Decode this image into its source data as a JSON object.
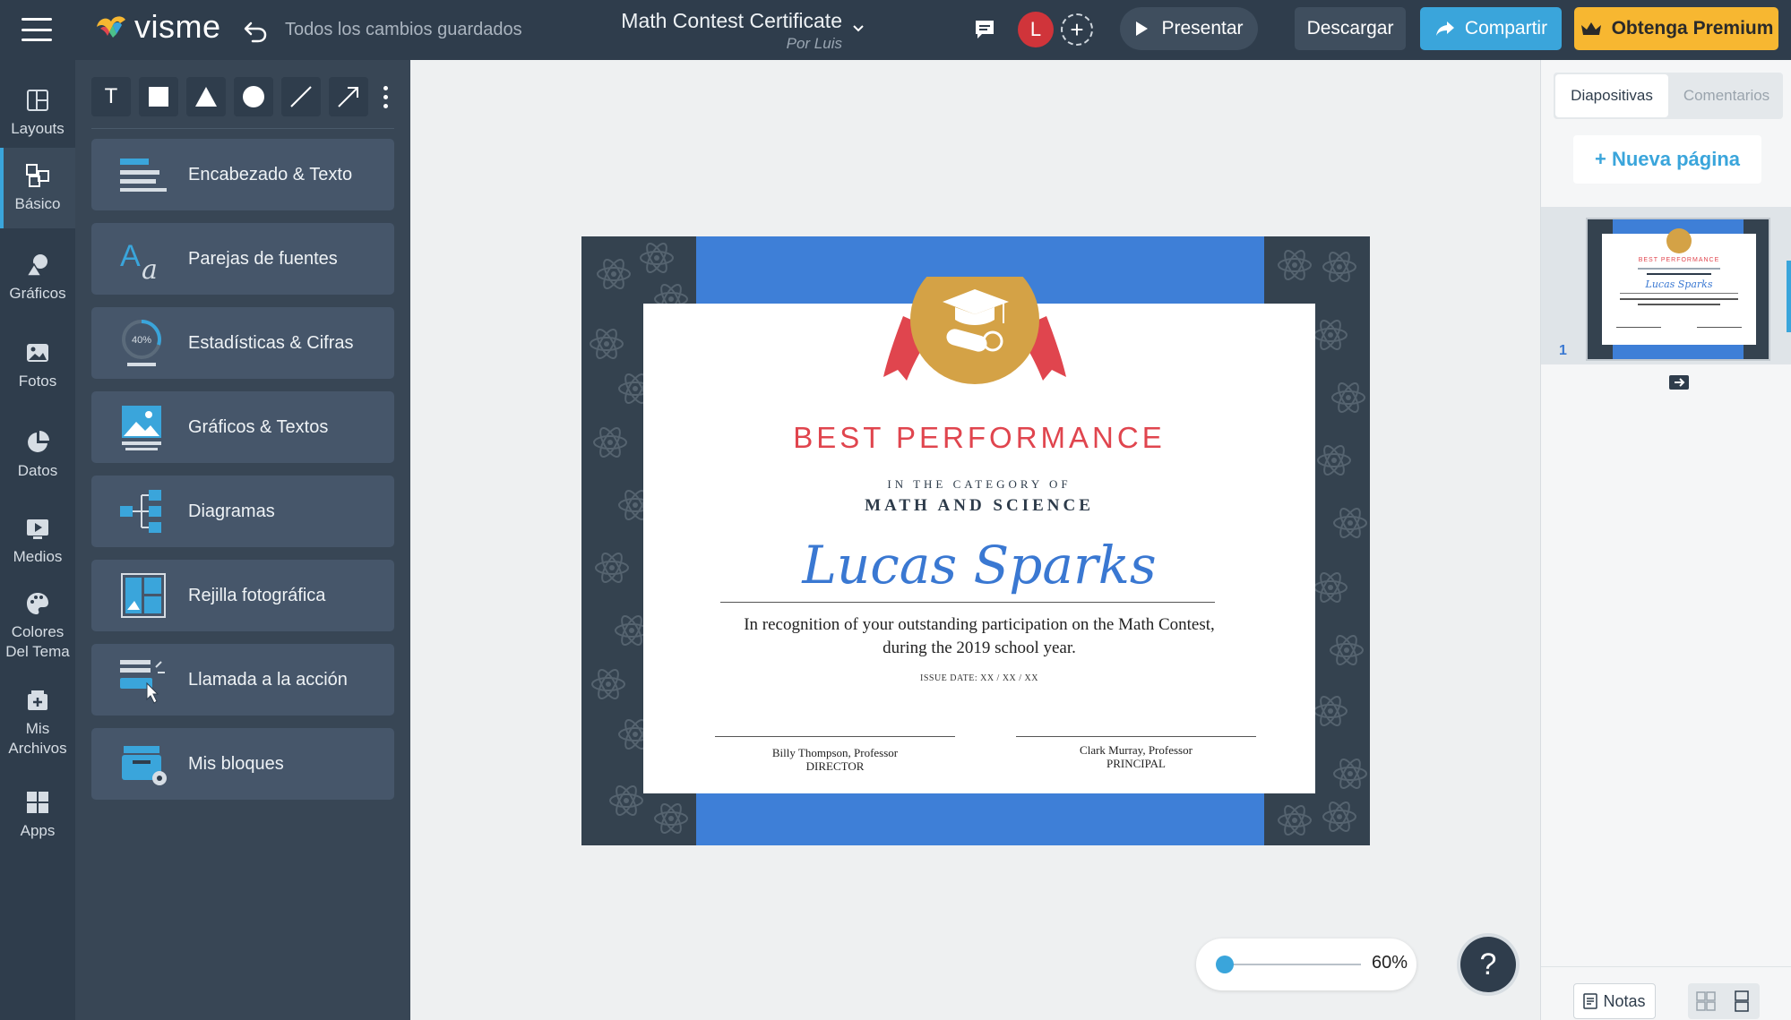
{
  "topbar": {
    "logo_text": "visme",
    "saved_status": "Todos los cambios guardados",
    "doc_title": "Math Contest Certificate",
    "doc_author": "Por Luis",
    "avatar_initial": "L",
    "present_label": "Presentar",
    "download_label": "Descargar",
    "share_label": "Compartir",
    "premium_label": "Obtenga Premium",
    "colors": {
      "bar": "#2f3d4c",
      "share": "#3aa5db",
      "premium": "#f7b731",
      "avatar": "#d0343a"
    }
  },
  "rail": {
    "items": [
      {
        "label": "Layouts",
        "icon": "layouts-icon"
      },
      {
        "label": "Básico",
        "icon": "basic-blocks-icon",
        "active": true
      },
      {
        "label": "Gráficos",
        "icon": "graphics-icon"
      },
      {
        "label": "Fotos",
        "icon": "photos-icon"
      },
      {
        "label": "Datos",
        "icon": "pie-chart-icon"
      },
      {
        "label": "Medios",
        "icon": "media-icon"
      },
      {
        "label": "Colores Del Tema",
        "icon": "palette-icon"
      },
      {
        "label": "Mis Archivos",
        "icon": "my-files-icon"
      },
      {
        "label": "Apps",
        "icon": "apps-icon"
      }
    ]
  },
  "panel": {
    "tools": [
      "text-tool",
      "rectangle-tool",
      "triangle-tool",
      "circle-tool",
      "line-tool",
      "arrow-tool"
    ],
    "text_tool_glyph": "T",
    "blocks": [
      {
        "label": "Encabezado & Texto",
        "icon": "heading-text-icon"
      },
      {
        "label": "Parejas de fuentes",
        "icon": "font-pairs-icon"
      },
      {
        "label": "Estadísticas & Cifras",
        "icon": "stats-figures-icon",
        "icon_text": "40%"
      },
      {
        "label": "Gráficos & Textos",
        "icon": "graphics-text-icon"
      },
      {
        "label": "Diagramas",
        "icon": "diagrams-icon"
      },
      {
        "label": "Rejilla fotográfica",
        "icon": "photo-grid-icon"
      },
      {
        "label": "Llamada a la acción",
        "icon": "call-to-action-icon"
      },
      {
        "label": "Mis bloques",
        "icon": "my-blocks-icon"
      }
    ]
  },
  "certificate": {
    "heading": "BEST PERFORMANCE",
    "category_intro": "IN THE CATEGORY OF",
    "category": "MATH AND SCIENCE",
    "recipient": "Lucas Sparks",
    "body_line1": "In recognition of your outstanding participation on the Math Contest,",
    "body_line2": "during the 2019 school year.",
    "issue_date": "ISSUE DATE: XX / XX / XX",
    "signer1_name": "Billy Thompson, Professor",
    "signer1_title": "DIRECTOR",
    "signer2_name": "Clark Murray, Professor",
    "signer2_title": "PRINCIPAL",
    "colors": {
      "frame": "#34424f",
      "band": "#3e7fd7",
      "heading": "#e0454e",
      "name": "#3a78d2",
      "badge": "#d4a246",
      "ribbon": "#e0454e"
    }
  },
  "zoom": {
    "value": "60%",
    "level": 0.05
  },
  "help_label": "?",
  "right_panel": {
    "tab_slides": "Diapositivas",
    "tab_comments": "Comentarios",
    "new_page_label": "+ Nueva página",
    "slide_number": "1",
    "notes_label": "Notas"
  }
}
